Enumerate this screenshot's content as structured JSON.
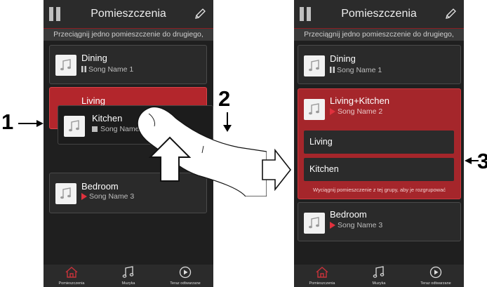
{
  "header": {
    "title": "Pomieszczenia"
  },
  "hint": "Przeciągnij jedno pomieszczenie do drugiego,",
  "left": {
    "rooms": [
      {
        "name": "Dining",
        "song": "Song Name 1",
        "state": "pause"
      },
      {
        "name": "Living"
      },
      {
        "name": "Kitchen",
        "song": "Song Name",
        "state": "stop"
      },
      {
        "name": "Bedroom",
        "song": "Song Name 3",
        "state": "play"
      }
    ]
  },
  "right": {
    "rooms": [
      {
        "name": "Dining",
        "song": "Song Name 1",
        "state": "pause"
      },
      {
        "name": "Living+Kitchen",
        "song": "Song Name 2",
        "state": "play"
      },
      {
        "name": "Bedroom",
        "song": "Song Name 3",
        "state": "play"
      }
    ],
    "group_members": [
      "Living",
      "Kitchen"
    ],
    "group_hint": "Wyciągnij pomieszczenie z tej grupy, aby je rozgrupować"
  },
  "tabs": [
    {
      "label": "Pomieszczenia",
      "icon": "home-icon"
    },
    {
      "label": "Muzyka",
      "icon": "music-notes-icon"
    },
    {
      "label": "Teraz odtwarzane",
      "icon": "play-circle-icon"
    }
  ],
  "callouts": [
    "1",
    "2",
    "3"
  ],
  "colors": {
    "accent": "#a5262b",
    "play": "#e0313d",
    "background": "#1f1f1f"
  }
}
